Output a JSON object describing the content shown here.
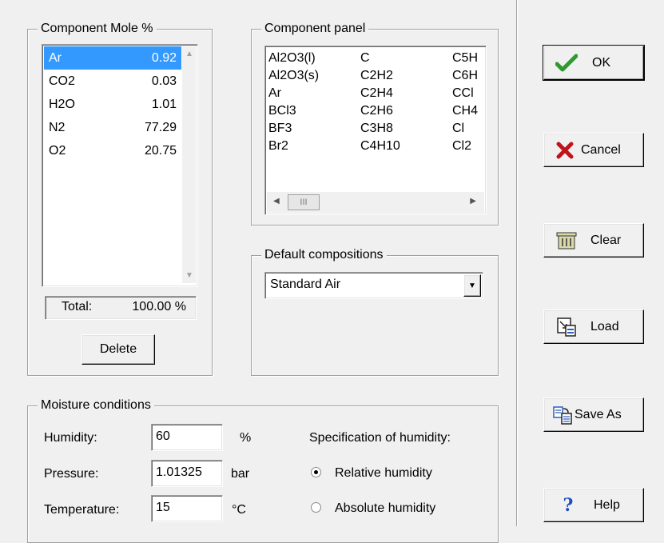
{
  "component_group": {
    "legend": "Component  Mole %",
    "items": [
      {
        "name": "Ar",
        "value": "0.92"
      },
      {
        "name": "CO2",
        "value": "0.03"
      },
      {
        "name": "H2O",
        "value": "1.01"
      },
      {
        "name": "N2",
        "value": "77.29"
      },
      {
        "name": "O2",
        "value": "20.75"
      }
    ],
    "total_label": "Total:",
    "total_value": "100.00 %",
    "delete_label": "Delete"
  },
  "component_panel": {
    "legend": "Component panel",
    "columns": [
      [
        "Al2O3(l)",
        "Al2O3(s)",
        "Ar",
        "BCl3",
        "BF3",
        "Br2"
      ],
      [
        "C",
        "C2H2",
        "C2H4",
        "C2H6",
        "C3H8",
        "C4H10"
      ],
      [
        "C5H",
        "C6H",
        "CCl",
        "CH4",
        "Cl",
        "Cl2"
      ]
    ],
    "thumb_text": "III"
  },
  "default_compositions": {
    "legend": "Default compositions",
    "selected": "Standard Air"
  },
  "moisture": {
    "legend": "Moisture conditions",
    "humidity_label": "Humidity:",
    "humidity_value": "60",
    "humidity_unit": "%",
    "pressure_label": "Pressure:",
    "pressure_value": "1.01325",
    "pressure_unit": "bar",
    "temperature_label": "Temperature:",
    "temperature_value": "15",
    "temperature_unit": "°C",
    "spec_label": "Specification of humidity:",
    "relative_label": "Relative humidity",
    "absolute_label": "Absolute humidity",
    "selected_spec": "Relative humidity"
  },
  "buttons": {
    "ok": "OK",
    "cancel": "Cancel",
    "clear": "Clear",
    "load": "Load",
    "save_as": "Save As",
    "help": "Help"
  },
  "colors": {
    "selection": "#3399ff",
    "ok_check": "#2e9a2e",
    "cancel_x": "#c0141c",
    "help_q": "#1f4fbf"
  }
}
